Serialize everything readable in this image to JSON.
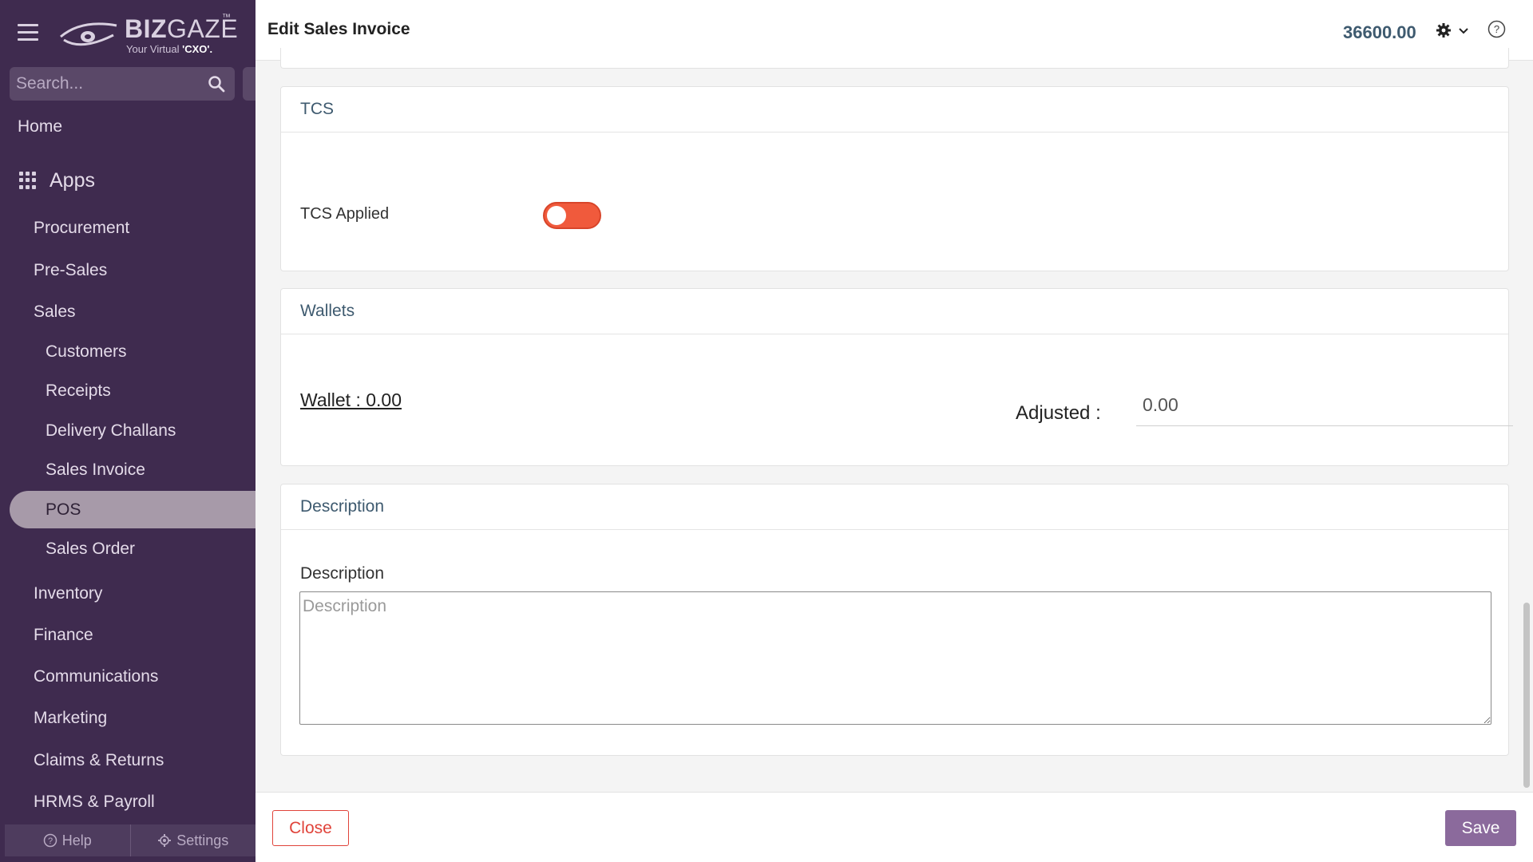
{
  "brand": {
    "name_bold": "BIZ",
    "name_light": "GAZE",
    "tm": "™",
    "tagline_prefix": "Your Virtual ",
    "tagline_bold": "'CXO'."
  },
  "sidebar": {
    "search_placeholder": "Search...",
    "home": "Home",
    "apps": "Apps",
    "categories": [
      {
        "label": "Procurement"
      },
      {
        "label": "Pre-Sales"
      },
      {
        "label": "Sales"
      }
    ],
    "sales_items": [
      {
        "label": "Customers"
      },
      {
        "label": "Receipts"
      },
      {
        "label": "Delivery Challans"
      },
      {
        "label": "Sales Invoice"
      },
      {
        "label": "POS",
        "active": true
      },
      {
        "label": "Sales Order"
      }
    ],
    "more_categories": [
      {
        "label": "Inventory"
      },
      {
        "label": "Finance"
      },
      {
        "label": "Communications"
      },
      {
        "label": "Marketing"
      },
      {
        "label": "Claims & Returns"
      },
      {
        "label": "HRMS & Payroll"
      }
    ],
    "footer": {
      "help": "Help",
      "settings": "Settings"
    }
  },
  "header": {
    "title": "Edit Sales Invoice",
    "amount": "36600.00"
  },
  "tcs": {
    "heading": "TCS",
    "label": "TCS Applied",
    "applied": false
  },
  "wallets": {
    "heading": "Wallets",
    "wallet_link": "Wallet : 0.00",
    "adjusted_label": "Adjusted :",
    "adjusted_value": "0.00"
  },
  "description": {
    "heading": "Description",
    "label": "Description",
    "placeholder": "Description",
    "value": ""
  },
  "footer": {
    "close": "Close",
    "save": "Save"
  },
  "colors": {
    "sidebar_bg": "#3f2b4f",
    "accent_purple": "#8b6a9c",
    "close_red": "#e0433a",
    "toggle_red": "#f05a3c",
    "heading_slate": "#3e5a6f"
  }
}
